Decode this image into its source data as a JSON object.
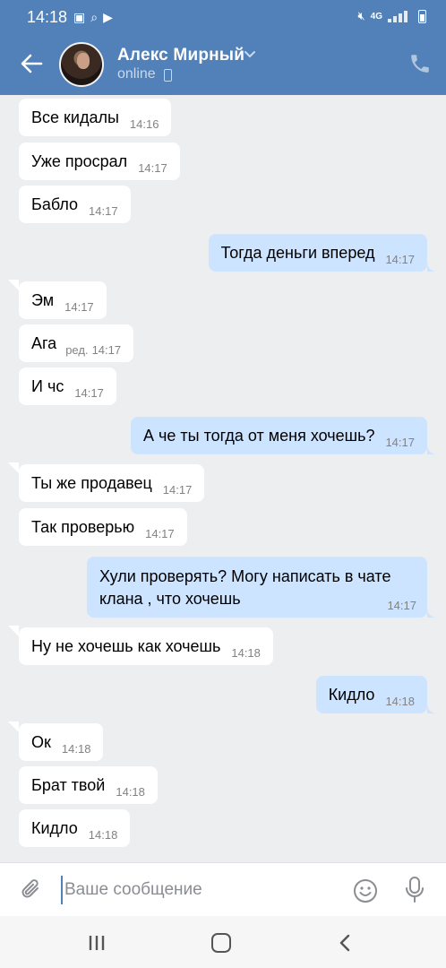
{
  "status_bar": {
    "time": "14:18",
    "network": "4G"
  },
  "header": {
    "contact_name": "Алекс Мирный",
    "status": "online"
  },
  "messages": [
    {
      "dir": "in",
      "text": "Все кидалы",
      "time": "14:16"
    },
    {
      "dir": "in",
      "text": "Уже просрал",
      "time": "14:17"
    },
    {
      "dir": "in",
      "text": "Бабло",
      "time": "14:17"
    },
    {
      "dir": "out",
      "text": "Тогда деньги вперед",
      "time": "14:17"
    },
    {
      "dir": "in",
      "text": "Эм",
      "time": "14:17"
    },
    {
      "dir": "in",
      "text": "Ага",
      "edited": "ред.",
      "time": "14:17"
    },
    {
      "dir": "in",
      "text": "И чс",
      "time": "14:17"
    },
    {
      "dir": "out",
      "text": "А че ты тогда от меня хочешь?",
      "time": "14:17"
    },
    {
      "dir": "in",
      "text": "Ты же продавец",
      "time": "14:17"
    },
    {
      "dir": "in",
      "text": "Так проверью",
      "time": "14:17"
    },
    {
      "dir": "out",
      "text": "Хули проверять? Могу написать в чате клана  , что хочешь",
      "time": "14:17"
    },
    {
      "dir": "in",
      "text": "Ну не хочешь как хочешь",
      "time": "14:18"
    },
    {
      "dir": "out",
      "text": "Кидло",
      "time": "14:18"
    },
    {
      "dir": "in",
      "text": "Ок",
      "time": "14:18"
    },
    {
      "dir": "in",
      "text": "Брат твой",
      "time": "14:18"
    },
    {
      "dir": "in",
      "text": "Кидло",
      "time": "14:18"
    }
  ],
  "composer": {
    "placeholder": "Ваше сообщение"
  },
  "colors": {
    "header": "#5181b8",
    "outgoing_bubble": "#cce4ff",
    "incoming_bubble": "#ffffff",
    "background": "#edeef0"
  }
}
